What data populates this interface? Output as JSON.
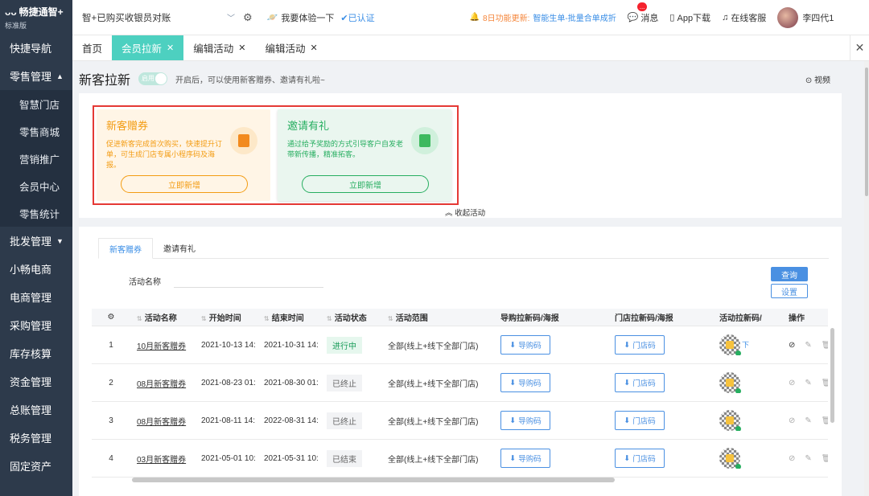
{
  "sidebar": {
    "brand": "畅捷通智+",
    "edition": "标准版",
    "items": [
      {
        "label": "快捷导航",
        "type": "item"
      },
      {
        "label": "零售管理",
        "type": "group",
        "expanded": true
      },
      {
        "label": "智慧门店",
        "type": "sub"
      },
      {
        "label": "零售商城",
        "type": "sub"
      },
      {
        "label": "营销推广",
        "type": "sub"
      },
      {
        "label": "会员中心",
        "type": "sub"
      },
      {
        "label": "零售统计",
        "type": "sub"
      },
      {
        "label": "批发管理",
        "type": "group",
        "expanded": false
      },
      {
        "label": "小畅电商",
        "type": "item"
      },
      {
        "label": "电商管理",
        "type": "item"
      },
      {
        "label": "采购管理",
        "type": "item"
      },
      {
        "label": "库存核算",
        "type": "item"
      },
      {
        "label": "资金管理",
        "type": "item"
      },
      {
        "label": "总账管理",
        "type": "item"
      },
      {
        "label": "税务管理",
        "type": "item"
      },
      {
        "label": "固定资产",
        "type": "item"
      }
    ]
  },
  "topbar": {
    "shop": "智+已购买收银员对账",
    "try_label": "我要体验一下",
    "verified": "已认证",
    "notice_date": "8日功能更新:",
    "notice_text": "智能生单-批量合单成折",
    "messages_label": "消息",
    "messages_badge": "...",
    "app_label": "App下载",
    "service_label": "在线客服",
    "username": "李四代1"
  },
  "tabs": [
    {
      "label": "首页",
      "closable": false,
      "active": false
    },
    {
      "label": "会员拉新",
      "closable": true,
      "active": true
    },
    {
      "label": "编辑活动",
      "closable": true,
      "active": false
    },
    {
      "label": "编辑活动",
      "closable": true,
      "active": false
    }
  ],
  "page": {
    "title": "新客拉新",
    "toggle_label": "启用",
    "hint": "开启后，可以使用新客赠券、邀请有礼啦~",
    "video_label": "视频",
    "collapse_label": "收起活动"
  },
  "cards": [
    {
      "title": "新客赠券",
      "desc": "促进新客完成首次购买，快速提升订单，可生成门店专属小程序码及海报。",
      "button": "立即新增",
      "theme": "orange"
    },
    {
      "title": "邀请有礼",
      "desc": "通过给予奖励的方式引导客户自发老带新传播，精准拓客。",
      "button": "立即新增",
      "theme": "green"
    }
  ],
  "list": {
    "subtabs": [
      "新客赠券",
      "邀请有礼"
    ],
    "filter_label": "活动名称",
    "query_button": "查询",
    "settings_button": "设置",
    "columns": [
      "",
      "活动名称",
      "开始时间",
      "结束时间",
      "活动状态",
      "活动范围",
      "导购拉新码/海报",
      "门店拉新码/海报",
      "活动拉新码/",
      "操作"
    ],
    "guide_code_label": "导购码",
    "store_code_label": "门店码",
    "download_label": "下",
    "rows": [
      {
        "index": "1",
        "name": "10月新客赠券",
        "start": "2021-10-13 14:",
        "end": "2021-10-31 14:",
        "status": "进行中",
        "active": true,
        "scope": "全部(线上+线下全部门店)"
      },
      {
        "index": "2",
        "name": "08月新客赠券",
        "start": "2021-08-23 01:",
        "end": "2021-08-30 01:",
        "status": "已终止",
        "active": false,
        "scope": "全部(线上+线下全部门店)"
      },
      {
        "index": "3",
        "name": "08月新客赠券",
        "start": "2021-08-11 14:",
        "end": "2022-08-31 14:",
        "status": "已终止",
        "active": false,
        "scope": "全部(线上+线下全部门店)"
      },
      {
        "index": "4",
        "name": "03月新客赠券",
        "start": "2021-05-01 10:",
        "end": "2021-05-31 10:",
        "status": "已结束",
        "active": false,
        "scope": "全部(线上+线下全部门店)"
      }
    ]
  },
  "colors": {
    "sidebar_bg": "#2d3a4b",
    "accent": "#4dd0c0",
    "link": "#3a8ee6",
    "highlight_border": "#e53935"
  }
}
